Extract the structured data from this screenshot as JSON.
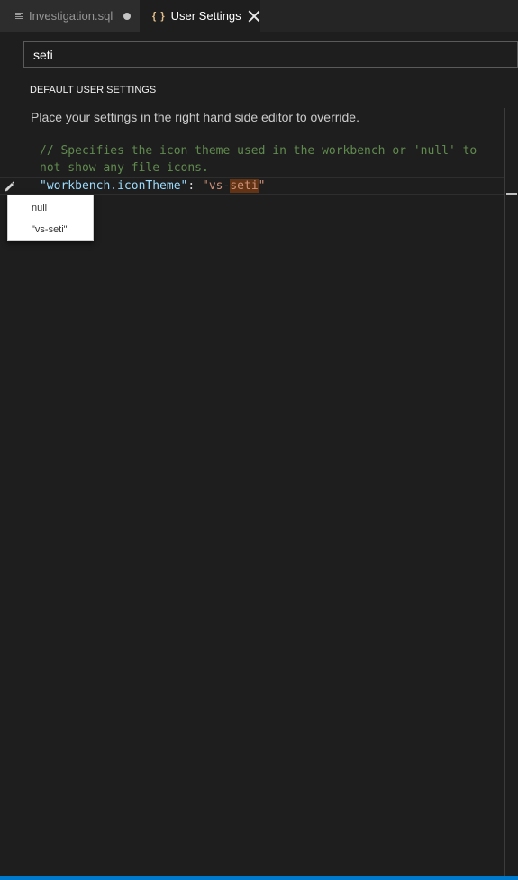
{
  "tabs": [
    {
      "label": "Investigation.sql",
      "icon": "file-lines-icon",
      "dirty": true
    },
    {
      "label": "User Settings",
      "icon": "curly-braces-icon",
      "brace": "{ }"
    }
  ],
  "search": {
    "value": "seti"
  },
  "section_title": "DEFAULT USER SETTINGS",
  "hint": "Place your settings in the right hand side editor to override.",
  "code": {
    "comment_line1": "// Specifies the icon theme used in the workbench or 'null' to",
    "comment_line2": "not show any file icons.",
    "key": "\"workbench.iconTheme\"",
    "colon": ": ",
    "value_open": "\"vs-",
    "value_match": "seti",
    "value_close": "\""
  },
  "edit_menu": {
    "items": [
      "null",
      "\"vs-seti\""
    ]
  },
  "colors": {
    "accent": "#007acc",
    "comment": "#608b4e",
    "key": "#9cdcfe",
    "string": "#ce9178",
    "match_highlight": "#623315"
  }
}
